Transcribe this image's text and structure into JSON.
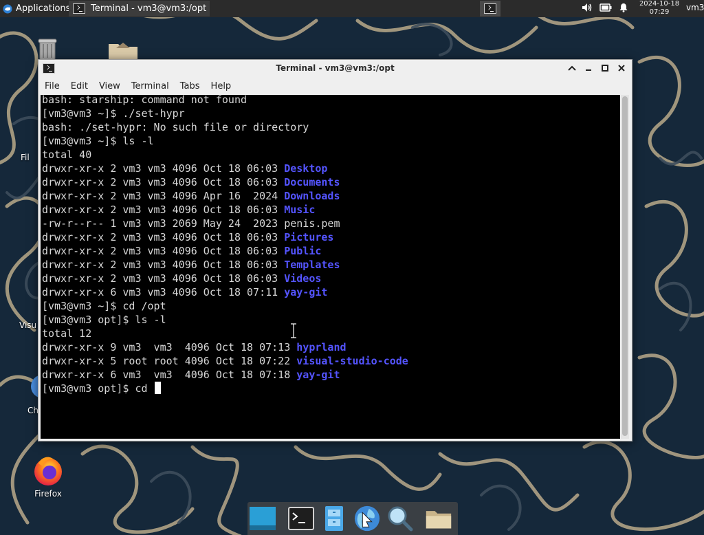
{
  "top_panel": {
    "apps_menu_label": "Applications",
    "task_title": "Terminal - vm3@vm3:/opt",
    "clock_date": "2024-10-18",
    "clock_time": "07:29",
    "user": "vm3"
  },
  "desktop_icons": [
    {
      "label": "Fil"
    },
    {
      "label": "Visu"
    },
    {
      "label": "Ch"
    },
    {
      "label": "Firefox"
    }
  ],
  "window": {
    "title": "Terminal - vm3@vm3:/opt",
    "menu": [
      "File",
      "Edit",
      "View",
      "Terminal",
      "Tabs",
      "Help"
    ]
  },
  "terminal": {
    "lines": [
      {
        "text": "bash: starship: command not found"
      },
      {
        "text": "[vm3@vm3 ~]$ ./set-hypr"
      },
      {
        "text": "bash: ./set-hypr: No such file or directory"
      },
      {
        "text": "[vm3@vm3 ~]$ ls -l"
      },
      {
        "text": "total 40"
      },
      {
        "text": "drwxr-xr-x 2 vm3 vm3 4096 Oct 18 06:03 ",
        "dir": "Desktop"
      },
      {
        "text": "drwxr-xr-x 2 vm3 vm3 4096 Oct 18 06:03 ",
        "dir": "Documents"
      },
      {
        "text": "drwxr-xr-x 2 vm3 vm3 4096 Apr 16  2024 ",
        "dir": "Downloads"
      },
      {
        "text": "drwxr-xr-x 2 vm3 vm3 4096 Oct 18 06:03 ",
        "dir": "Music"
      },
      {
        "text": "-rw-r--r-- 1 vm3 vm3 2069 May 24  2023 penis.pem"
      },
      {
        "text": "drwxr-xr-x 2 vm3 vm3 4096 Oct 18 06:03 ",
        "dir": "Pictures"
      },
      {
        "text": "drwxr-xr-x 2 vm3 vm3 4096 Oct 18 06:03 ",
        "dir": "Public"
      },
      {
        "text": "drwxr-xr-x 2 vm3 vm3 4096 Oct 18 06:03 ",
        "dir": "Templates"
      },
      {
        "text": "drwxr-xr-x 2 vm3 vm3 4096 Oct 18 06:03 ",
        "dir": "Videos"
      },
      {
        "text": "drwxr-xr-x 6 vm3 vm3 4096 Oct 18 07:11 ",
        "dir": "yay-git"
      },
      {
        "text": "[vm3@vm3 ~]$ cd /opt"
      },
      {
        "text": "[vm3@vm3 opt]$ ls -l"
      },
      {
        "text": "total 12"
      },
      {
        "text": "drwxr-xr-x 9 vm3  vm3  4096 Oct 18 07:13 ",
        "dir": "hyprland"
      },
      {
        "text": "drwxr-xr-x 5 root root 4096 Oct 18 07:22 ",
        "dir": "visual-studio-code"
      },
      {
        "text": "drwxr-xr-x 6 vm3  vm3  4096 Oct 18 07:18 ",
        "dir": "yay-git"
      },
      {
        "text": "[vm3@vm3 opt]$ cd ",
        "cursor": true
      }
    ]
  },
  "dock_items": [
    "show-desktop-icon",
    "terminal-icon",
    "file-manager-icon",
    "web-browser-icon",
    "app-finder-icon",
    "folder-icon"
  ],
  "colors": {
    "panel_bg": "#2b2b2b",
    "terminal_bg": "#000000",
    "terminal_fg": "#d6d6d6",
    "directory": "#5454ff",
    "wallpaper": "#15283a"
  }
}
